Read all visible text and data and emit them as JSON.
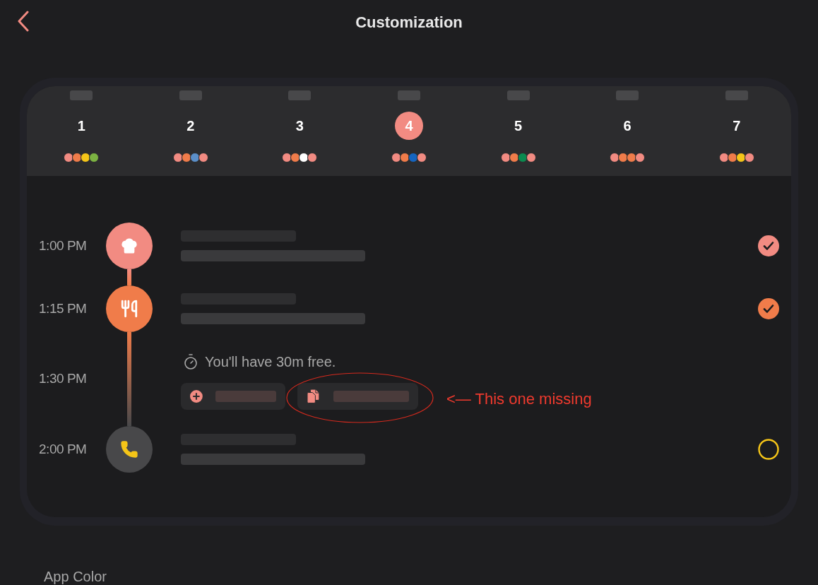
{
  "header": {
    "title": "Customization"
  },
  "days": [
    {
      "label": "1",
      "selected": false,
      "dots": [
        {
          "color": "#f28b82"
        },
        {
          "color": "#f07c4a"
        },
        {
          "color": "#f5c518"
        },
        {
          "color": "#7cb342"
        }
      ]
    },
    {
      "label": "2",
      "selected": false,
      "dots": [
        {
          "color": "#f28b82"
        },
        {
          "color": "#f07c4a"
        },
        {
          "color": "#5b8fc9"
        },
        {
          "color": "#f28b82"
        }
      ]
    },
    {
      "label": "3",
      "selected": false,
      "dots": [
        {
          "color": "#f28b82"
        },
        {
          "color": "#f07c4a"
        },
        {
          "color": "#ffffff"
        },
        {
          "color": "#f28b82"
        }
      ]
    },
    {
      "label": "4",
      "selected": true,
      "dots": [
        {
          "color": "#f28b82"
        },
        {
          "color": "#f07c4a"
        },
        {
          "color": "#1565c0"
        },
        {
          "color": "#f28b82"
        }
      ]
    },
    {
      "label": "5",
      "selected": false,
      "dots": [
        {
          "color": "#f28b82"
        },
        {
          "color": "#f07c4a"
        },
        {
          "color": "#0b8a4f"
        },
        {
          "color": "#f28b82"
        }
      ]
    },
    {
      "label": "6",
      "selected": false,
      "dots": [
        {
          "color": "#f28b82"
        },
        {
          "color": "#f07c4a"
        },
        {
          "color": "#f07c4a"
        },
        {
          "color": "#f28b82"
        }
      ]
    },
    {
      "label": "7",
      "selected": false,
      "dots": [
        {
          "color": "#f28b82"
        },
        {
          "color": "#f07c4a"
        },
        {
          "color": "#f5c518"
        },
        {
          "color": "#f28b82"
        }
      ]
    }
  ],
  "timeline": [
    {
      "kind": "event",
      "time": "1:00 PM",
      "color": "#f28b82",
      "checked": true
    },
    {
      "kind": "event",
      "time": "1:15 PM",
      "color": "#f07c4a",
      "checked": true
    },
    {
      "kind": "gap",
      "time": "1:30 PM",
      "message": "You'll have 30m free.",
      "actions": [
        {
          "kind": "add"
        },
        {
          "kind": "copy",
          "annotation": "<— This one missing"
        }
      ]
    },
    {
      "kind": "event",
      "time": "2:00 PM",
      "color": "#f5c518",
      "checked": false
    }
  ],
  "section": {
    "title": "App Color"
  }
}
